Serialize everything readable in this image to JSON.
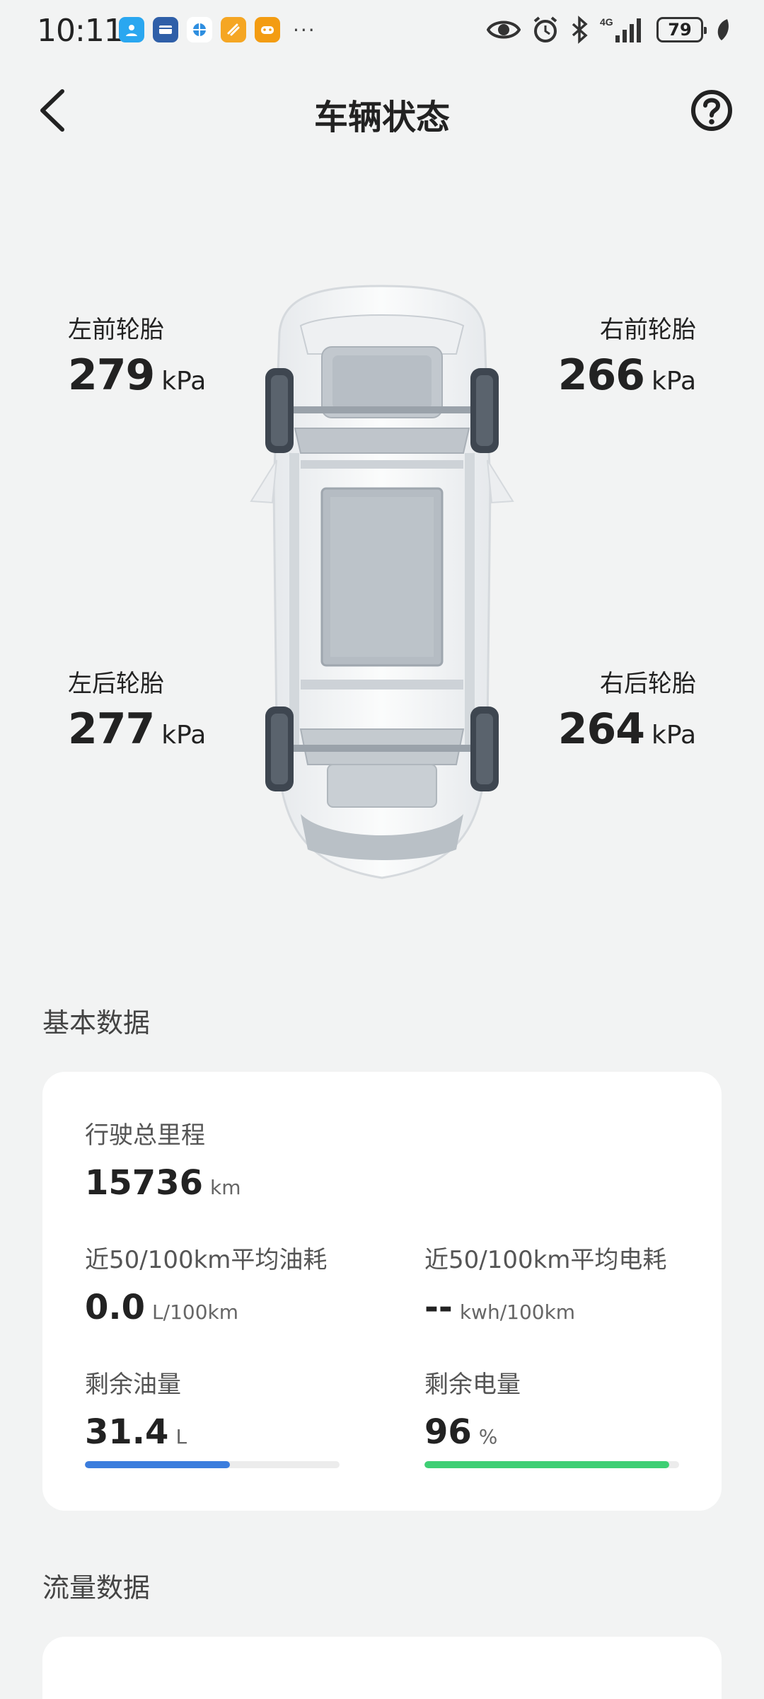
{
  "status_bar": {
    "time": "10:11",
    "battery": "79",
    "icons": [
      "contacts-app-icon",
      "wallet-app-icon",
      "browser-app-icon",
      "notes-app-icon",
      "game-app-icon"
    ],
    "more": "···",
    "system_icons": [
      "eye-comfort-icon",
      "alarm-icon",
      "bluetooth-icon",
      "signal-4g-icon",
      "battery-icon",
      "leaf-icon"
    ],
    "network": "4G"
  },
  "header": {
    "title": "车辆状态"
  },
  "tires": {
    "front_left": {
      "label": "左前轮胎",
      "value": "279",
      "unit": "kPa"
    },
    "front_right": {
      "label": "右前轮胎",
      "value": "266",
      "unit": "kPa"
    },
    "rear_left": {
      "label": "左后轮胎",
      "value": "277",
      "unit": "kPa"
    },
    "rear_right": {
      "label": "右后轮胎",
      "value": "264",
      "unit": "kPa"
    }
  },
  "basic": {
    "title": "基本数据",
    "odometer": {
      "label": "行驶总里程",
      "value": "15736",
      "unit": "km"
    },
    "avg_fuel": {
      "label": "近50/100km平均油耗",
      "value": "0.0",
      "unit": "L/100km"
    },
    "avg_power": {
      "label": "近50/100km平均电耗",
      "value": "--",
      "unit": "kwh/100km"
    },
    "fuel_left": {
      "label": "剩余油量",
      "value": "31.4",
      "unit": "L",
      "fraction": 0.57
    },
    "battery_left": {
      "label": "剩余电量",
      "value": "96",
      "unit": "%",
      "fraction": 0.96
    }
  },
  "traffic": {
    "title": "流量数据"
  },
  "colors": {
    "background": "#f2f3f3",
    "fuel_bar": "#3b7ddd",
    "battery_bar": "#3ecf74"
  }
}
